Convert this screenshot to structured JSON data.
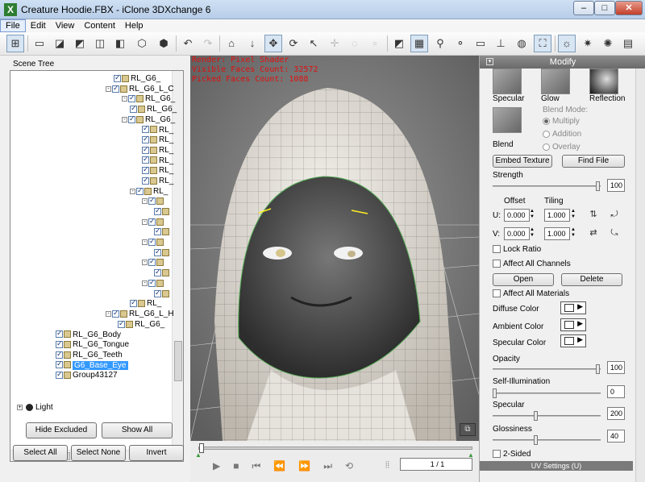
{
  "window": {
    "title": "Creature Hoodie.FBX - iClone 3DXchange 6",
    "minimize": "–",
    "maximize": "□",
    "close": "✕"
  },
  "menu": [
    "File",
    "Edit",
    "View",
    "Content",
    "Help"
  ],
  "toolbar": {
    "icons": [
      "scene-tree-icon",
      "open-folder-icon",
      "import-icon",
      "fbx-icon",
      "bvh-icon",
      "obj-icon",
      "export-icon",
      "export-2-icon",
      "undo-icon",
      "redo-icon",
      "home-icon",
      "move-down-icon",
      "move-icon",
      "rotate-icon",
      "select-icon",
      "snap-icon",
      "scale-icon",
      "reset-icon",
      "wireframe-icon",
      "grid-icon",
      "bone-icon",
      "light-icon",
      "box-icon",
      "ground-icon",
      "globe-icon",
      "frame-icon",
      "light-bulb-icon",
      "sun-icon",
      "spot-icon",
      "picture-icon"
    ]
  },
  "scene_tree": {
    "label": "Scene Tree",
    "rows": [
      {
        "text": "RL_G6_",
        "indent": 140
      },
      {
        "text": "RL_G6_L_C",
        "indent": 130,
        "exp": "-"
      },
      {
        "text": "RL_G6_",
        "indent": 150,
        "exp": "-"
      },
      {
        "text": "RL_G6_",
        "indent": 160
      },
      {
        "text": "RL_G6_",
        "indent": 150,
        "exp": "-"
      },
      {
        "text": "RL_",
        "indent": 175
      },
      {
        "text": "RL_",
        "indent": 175
      },
      {
        "text": "RL_",
        "indent": 175
      },
      {
        "text": "RL_",
        "indent": 175
      },
      {
        "text": "RL_",
        "indent": 175
      },
      {
        "text": "RL_",
        "indent": 175
      },
      {
        "text": "RL_",
        "indent": 160,
        "exp": "-"
      },
      {
        "text": "",
        "indent": 175,
        "exp": "-"
      },
      {
        "text": "",
        "indent": 190
      },
      {
        "text": "",
        "indent": 175,
        "exp": "-"
      },
      {
        "text": "",
        "indent": 190
      },
      {
        "text": "",
        "indent": 175,
        "exp": "-"
      },
      {
        "text": "",
        "indent": 190
      },
      {
        "text": "",
        "indent": 175,
        "exp": "-"
      },
      {
        "text": "",
        "indent": 190
      },
      {
        "text": "",
        "indent": 175,
        "exp": "-"
      },
      {
        "text": "",
        "indent": 190
      },
      {
        "text": "RL_",
        "indent": 160
      },
      {
        "text": "RL_G6_L_H",
        "indent": 130,
        "exp": "-"
      },
      {
        "text": "RL_G6_",
        "indent": 145
      },
      {
        "text": "RL_G6_Body",
        "indent": 68
      },
      {
        "text": "RL_G6_Tongue",
        "indent": 68
      },
      {
        "text": "RL_G6_Teeth",
        "indent": 68
      },
      {
        "text": "G6_Base_Eye",
        "indent": 68,
        "selected": true
      },
      {
        "text": "Group43127",
        "indent": 68
      }
    ],
    "light_label": "Light"
  },
  "left_buttons": {
    "hide_excluded": "Hide Excluded",
    "show_all": "Show All",
    "select_all": "Select All",
    "select_none": "Select None",
    "invert": "Invert"
  },
  "viewport": {
    "render": "Render: Pixel Shader",
    "visible_faces": "Visible Faces Count: 32572",
    "picked_faces": "Picked Faces Count: 1088"
  },
  "playback": {
    "frame": "1 / 1",
    "progress": 0
  },
  "modify": {
    "title": "Modify",
    "channels": {
      "specular": "Specular",
      "glow": "Glow",
      "reflection": "Reflection",
      "blend": "Blend"
    },
    "blend_mode": {
      "label": "Blend Mode:",
      "options": [
        "Multiply",
        "Addition",
        "Overlay"
      ],
      "selected": "Multiply"
    },
    "embed_texture": "Embed Texture",
    "find_file": "Find File",
    "strength": {
      "label": "Strength",
      "value": "100",
      "level": 1.0
    },
    "offset_label": "Offset",
    "tiling_label": "Tiling",
    "u_label": "U:",
    "v_label": "V:",
    "u_offset": "0.000",
    "u_tiling": "1.000",
    "v_offset": "0.000",
    "v_tiling": "1.000",
    "lock_ratio": "Lock Ratio",
    "affect_all_channels": "Affect All Channels",
    "open": "Open",
    "delete": "Delete",
    "affect_all_materials": "Affect All Materials",
    "diffuse_color": "Diffuse Color",
    "ambient_color": "Ambient Color",
    "specular_color": "Specular Color",
    "opacity": {
      "label": "Opacity",
      "value": "100",
      "level": 1.0
    },
    "self_illum": {
      "label": "Self-Illumination",
      "value": "0",
      "level": 0.0
    },
    "specular": {
      "label": "Specular",
      "value": "200",
      "level": 0.4
    },
    "glossiness": {
      "label": "Glossiness",
      "value": "40",
      "level": 0.4
    },
    "two_sided": "2-Sided",
    "uv_settings": "UV Settings (U)"
  }
}
